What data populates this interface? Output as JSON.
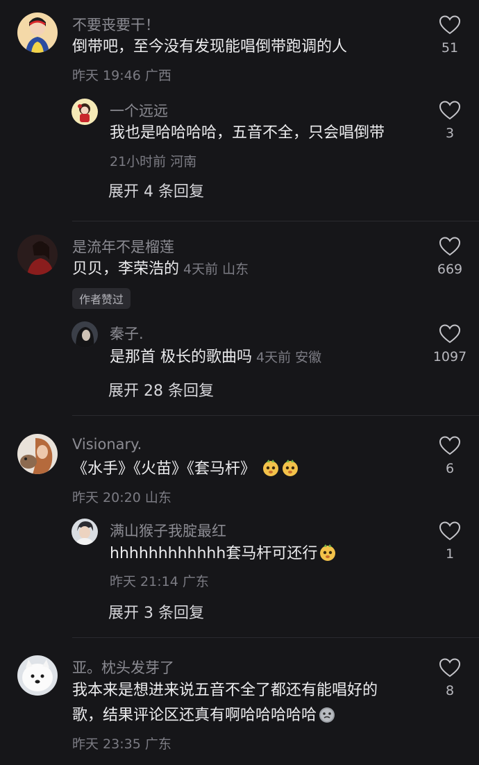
{
  "comments": [
    {
      "author": "不要丧要干！",
      "text": "倒带吧，至今没有发现能唱倒带跑调的人",
      "meta": "昨天 19:46 广西",
      "likes": "51",
      "avatar_icon": "snow-white-avatar",
      "reply": {
        "author": "一个远远",
        "text": "我也是哈哈哈哈，五音不全，只会唱倒带",
        "meta": "21小时前 河南",
        "likes": "3",
        "avatar_icon": "cartoon-girl-avatar"
      },
      "expand_label": "展开 4 条回复"
    },
    {
      "author": "是流年不是榴莲",
      "text": "贝贝，李荣浩的",
      "meta": "4天前 山东",
      "likes": "669",
      "badge": "作者赞过",
      "avatar_icon": "woman-red-avatar",
      "reply": {
        "author": "秦子.",
        "text": "是那首 极长的歌曲吗",
        "meta": "4天前 安徽",
        "likes": "1097",
        "avatar_icon": "dark-hair-avatar"
      },
      "expand_label": "展开 28 条回复"
    },
    {
      "author": "Visionary.",
      "text": "《水手》《火苗》《套马杆》",
      "meta": "昨天 20:20 山东",
      "likes": "6",
      "avatar_icon": "woman-dog-avatar",
      "reply": {
        "author": "满山猴子我腚最红",
        "text": "hhhhhhhhhhhh套马杆可还行",
        "meta": "昨天 21:14 广东",
        "likes": "1",
        "avatar_icon": "boy-avatar"
      },
      "expand_label": "展开 3 条回复"
    },
    {
      "author": "亚。枕头发芽了",
      "text_line1": "我本来是想进来说五音不全了都还有能唱好的",
      "text_line2": "歌，结果评论区还真有啊哈哈哈哈哈",
      "meta": "昨天 23:35 广东",
      "likes": "8",
      "avatar_icon": "samoyed-dog-avatar"
    }
  ],
  "colors": {
    "background": "#161619",
    "name": "#8b8b92",
    "text": "#ececee",
    "meta": "#7c7c84"
  }
}
